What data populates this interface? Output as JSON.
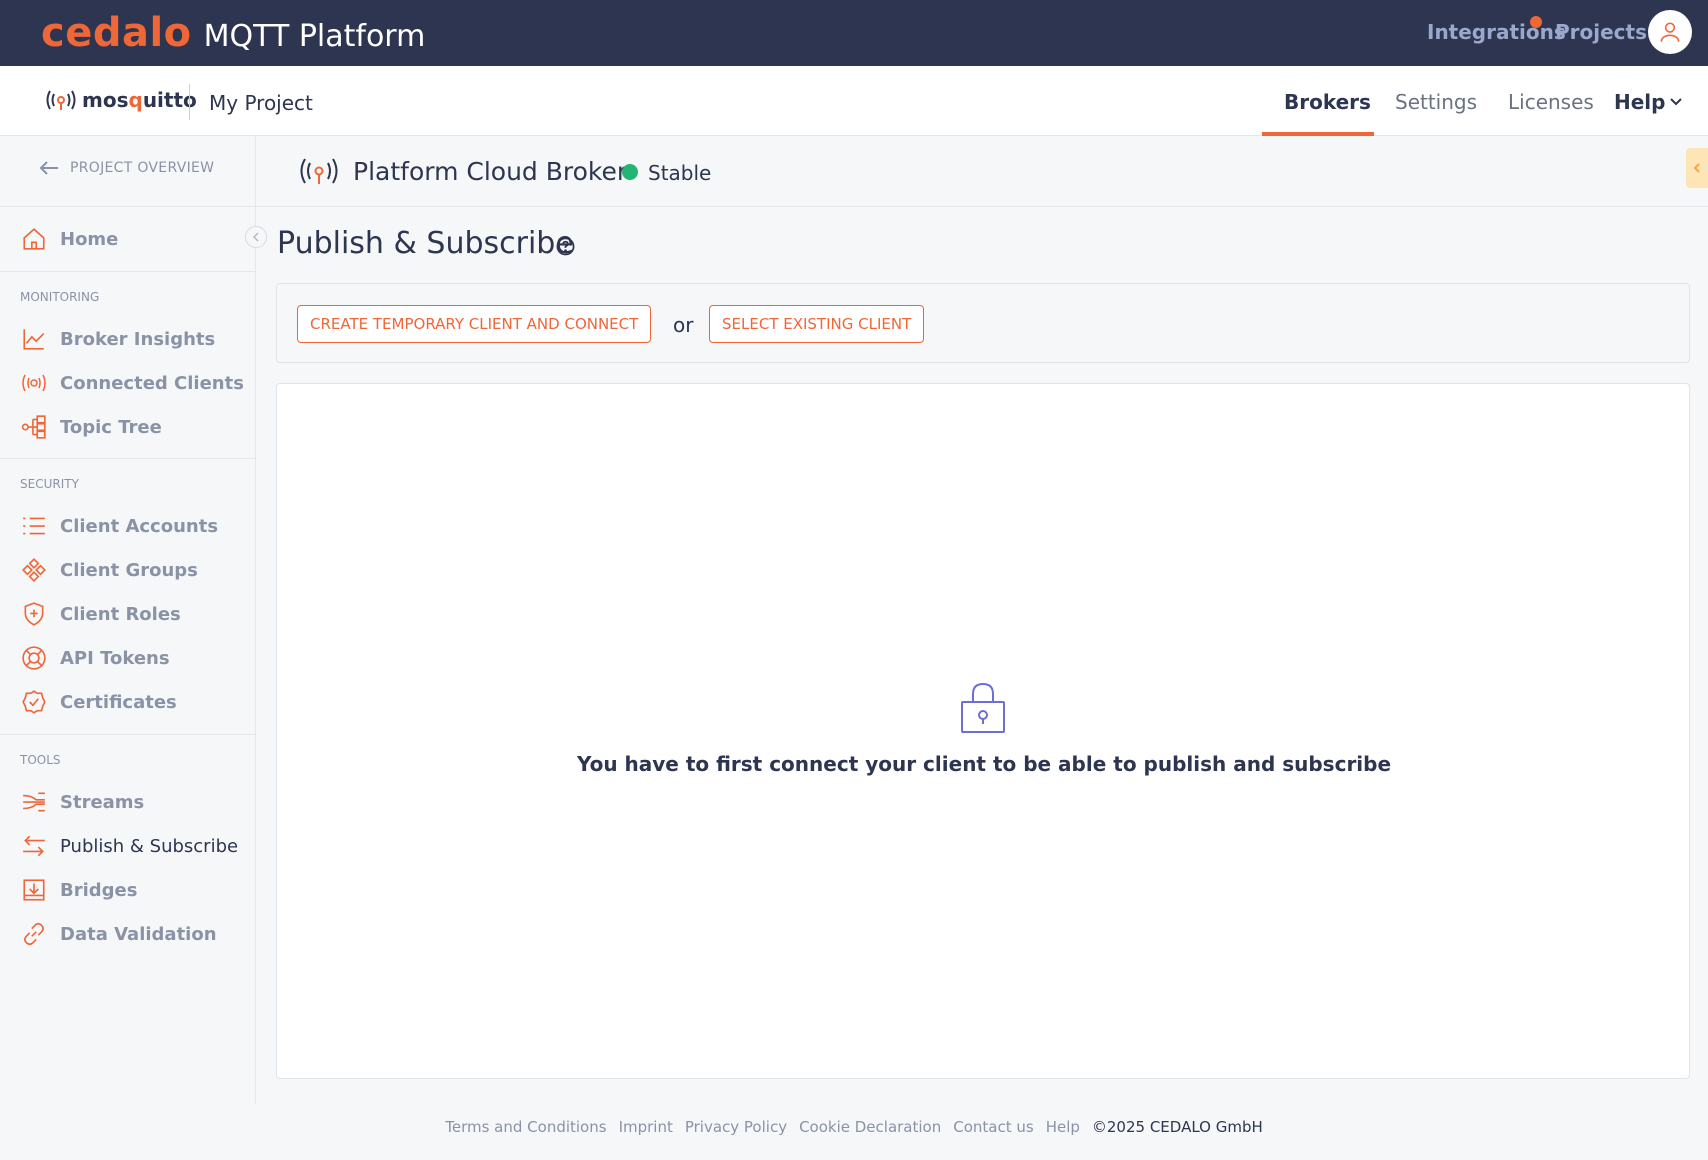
{
  "topbar": {
    "brand": "cedalo",
    "product": "MQTT Platform",
    "integrations_label": "Integrations",
    "projects_label": "Projects"
  },
  "subbar": {
    "logo_text_a": "mos",
    "logo_text_o": "q",
    "logo_text_b": "uitto",
    "project_name": "My Project",
    "nav": [
      "Brokers",
      "Settings",
      "Licenses",
      "Help"
    ],
    "active_nav": "Brokers"
  },
  "sidebar": {
    "back_label": "PROJECT OVERVIEW",
    "home": "Home",
    "sections": {
      "monitoring": "MONITORING",
      "security": "SECURITY",
      "tools": "TOOLS"
    },
    "monitoring_items": [
      "Broker Insights",
      "Connected Clients",
      "Topic Tree"
    ],
    "security_items": [
      "Client Accounts",
      "Client Groups",
      "Client Roles",
      "API Tokens",
      "Certificates"
    ],
    "tools_items": [
      "Streams",
      "Publish & Subscribe",
      "Bridges",
      "Data Validation"
    ],
    "active_item": "Publish & Subscribe"
  },
  "broker": {
    "name": "Platform Cloud Broker",
    "status": "Stable",
    "status_color": "#22b573"
  },
  "main": {
    "title": "Publish & Subscribe",
    "create_button": "CREATE TEMPORARY CLIENT AND CONNECT",
    "or_text": "or",
    "select_button": "SELECT EXISTING CLIENT",
    "empty_message": "You have to first connect your client to be able to publish and subscribe"
  },
  "footer": {
    "links": [
      "Terms and Conditions",
      "Imprint",
      "Privacy Policy",
      "Cookie Declaration",
      "Contact us",
      "Help"
    ],
    "copyright": "©2025 CEDALO GmbH"
  },
  "colors": {
    "accent": "#ef6637",
    "topbar": "#2d3550",
    "text": "#2d3550",
    "muted": "#8a93a6"
  }
}
